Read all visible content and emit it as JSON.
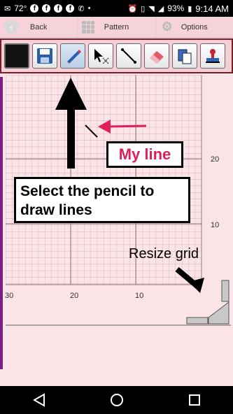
{
  "status_bar": {
    "temperature": "72°",
    "battery": "93%",
    "time": "9:14 AM"
  },
  "nav": {
    "back_label": "Back",
    "pattern_label": "Pattern",
    "options_label": "Options"
  },
  "toolbar": {
    "tools": [
      "color-swatch",
      "save",
      "pencil",
      "select",
      "line",
      "eraser",
      "paste",
      "stamp"
    ],
    "selected_tool": "pencil"
  },
  "grid": {
    "x_ticks": [
      "30",
      "20",
      "10"
    ],
    "y_ticks": [
      "20",
      "10"
    ]
  },
  "annotations": {
    "my_line": "My line",
    "select_pencil": "Select the pencil to draw lines",
    "resize_grid": "Resize grid"
  },
  "colors": {
    "accent_pink": "#e0205a",
    "grid_line": "#c9a4ab",
    "toolbar_border": "#7a1a2a",
    "background": "#fbe4e7"
  }
}
